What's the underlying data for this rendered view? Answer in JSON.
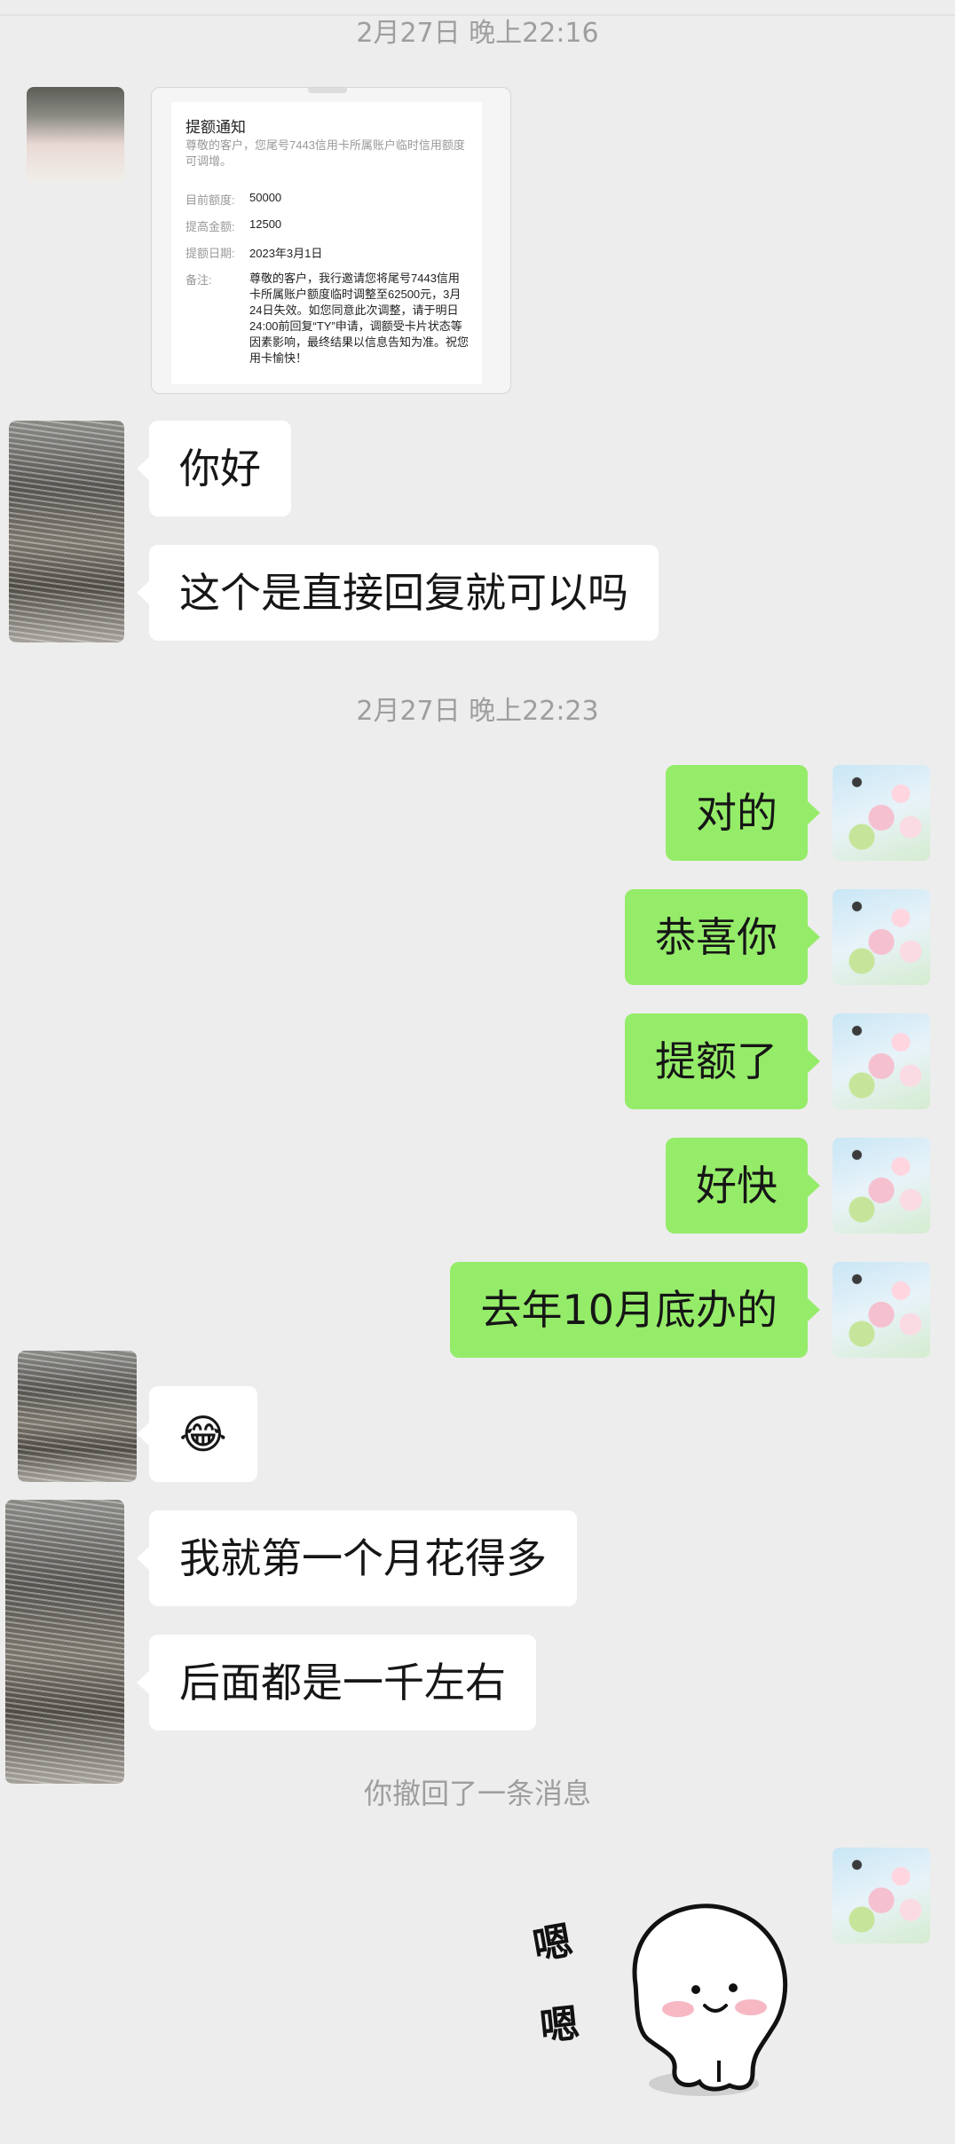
{
  "chat": {
    "timestamp1": "2月27日 晚上22:16",
    "timestamp2": "2月27日 晚上22:23",
    "recall_notice": "你撤回了一条消息"
  },
  "card": {
    "title": "提额通知",
    "description": "尊敬的客户，您尾号7443信用卡所属账户临时信用额度可调增。",
    "rows": [
      {
        "label": "目前额度:",
        "value": "50000"
      },
      {
        "label": "提高金额:",
        "value": "12500"
      },
      {
        "label": "提额日期:",
        "value": "2023年3月1日"
      }
    ],
    "note_label": "备注:",
    "note": "尊敬的客户，我行邀请您将尾号7443信用卡所属账户额度临时调整至62500元，3月24日失效。如您同意此次调整，请于明日24:00前回复“TY”申请，调额受卡片状态等因素影响，最终结果以信息告知为准。祝您用卡愉快！"
  },
  "messages": {
    "m1": "你好",
    "m2": "这个是直接回复就可以吗",
    "m3": "对的",
    "m4": "恭喜你",
    "m5": "提额了",
    "m6": "好快",
    "m7": "去年10月底办的",
    "m8": "😂",
    "m9": "我就第一个月花得多",
    "m10": "后面都是一千左右"
  },
  "sticker": {
    "text1": "嗯",
    "text2": "嗯"
  },
  "colors": {
    "background": "#ededed",
    "incoming_bubble": "#ffffff",
    "outgoing_bubble": "#95ec69"
  }
}
